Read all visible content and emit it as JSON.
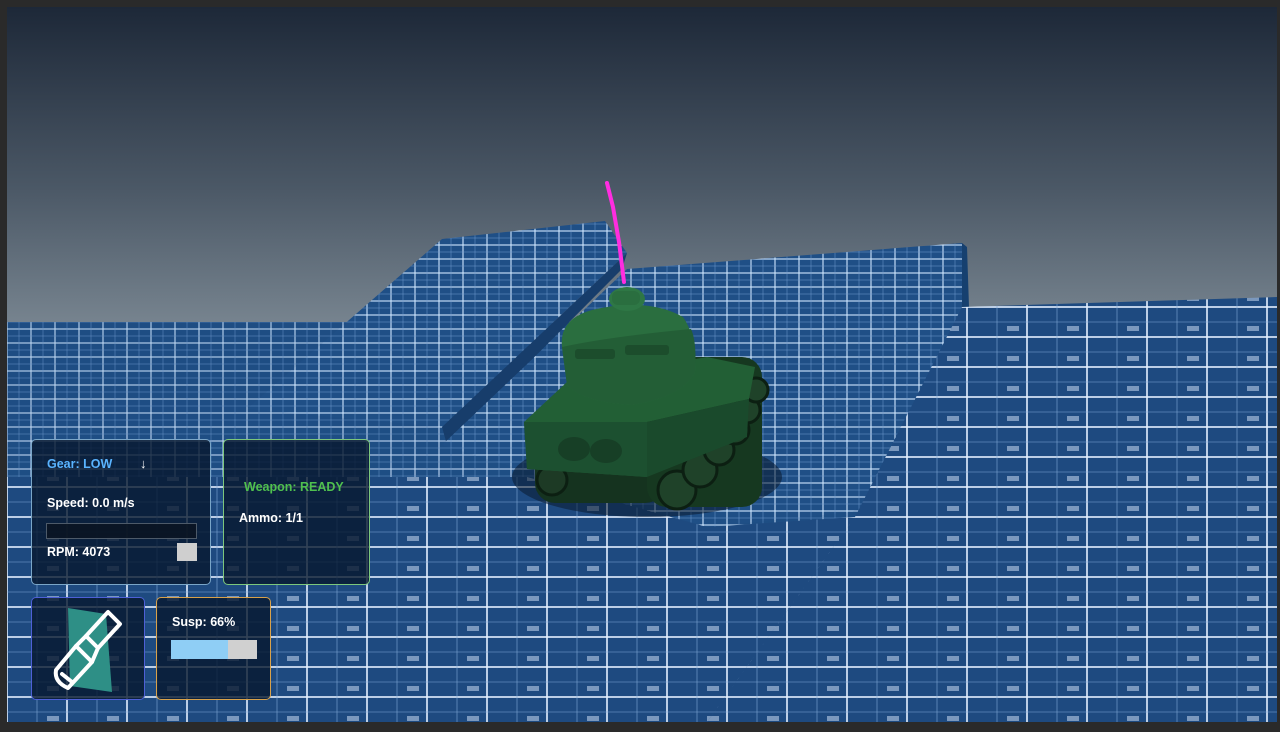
{
  "hud": {
    "gear": {
      "label": "Gear: LOW",
      "arrow": "↓"
    },
    "speed": {
      "label": "Speed: 0.0 m/s",
      "fraction": 0.0
    },
    "rpm": {
      "label": "RPM: 4073"
    },
    "weapon": {
      "status": "Weapon: READY",
      "ammo": "Ammo: 1/1"
    },
    "suspension": {
      "label": "Susp: 66%",
      "fraction": 0.66
    },
    "tool": {
      "icon": "paint-brush-icon"
    }
  },
  "colors": {
    "gear_accent": "#5ab4ff",
    "weapon_ready": "#4fc04f",
    "tank_body": "#1f5e34",
    "laser": "#ff2de0",
    "grid_tile": "#1f4f86",
    "grid_line": "#cfe6ff",
    "sky_top": "#1e2a3c",
    "sky_horizon": "#6f7f8c"
  }
}
